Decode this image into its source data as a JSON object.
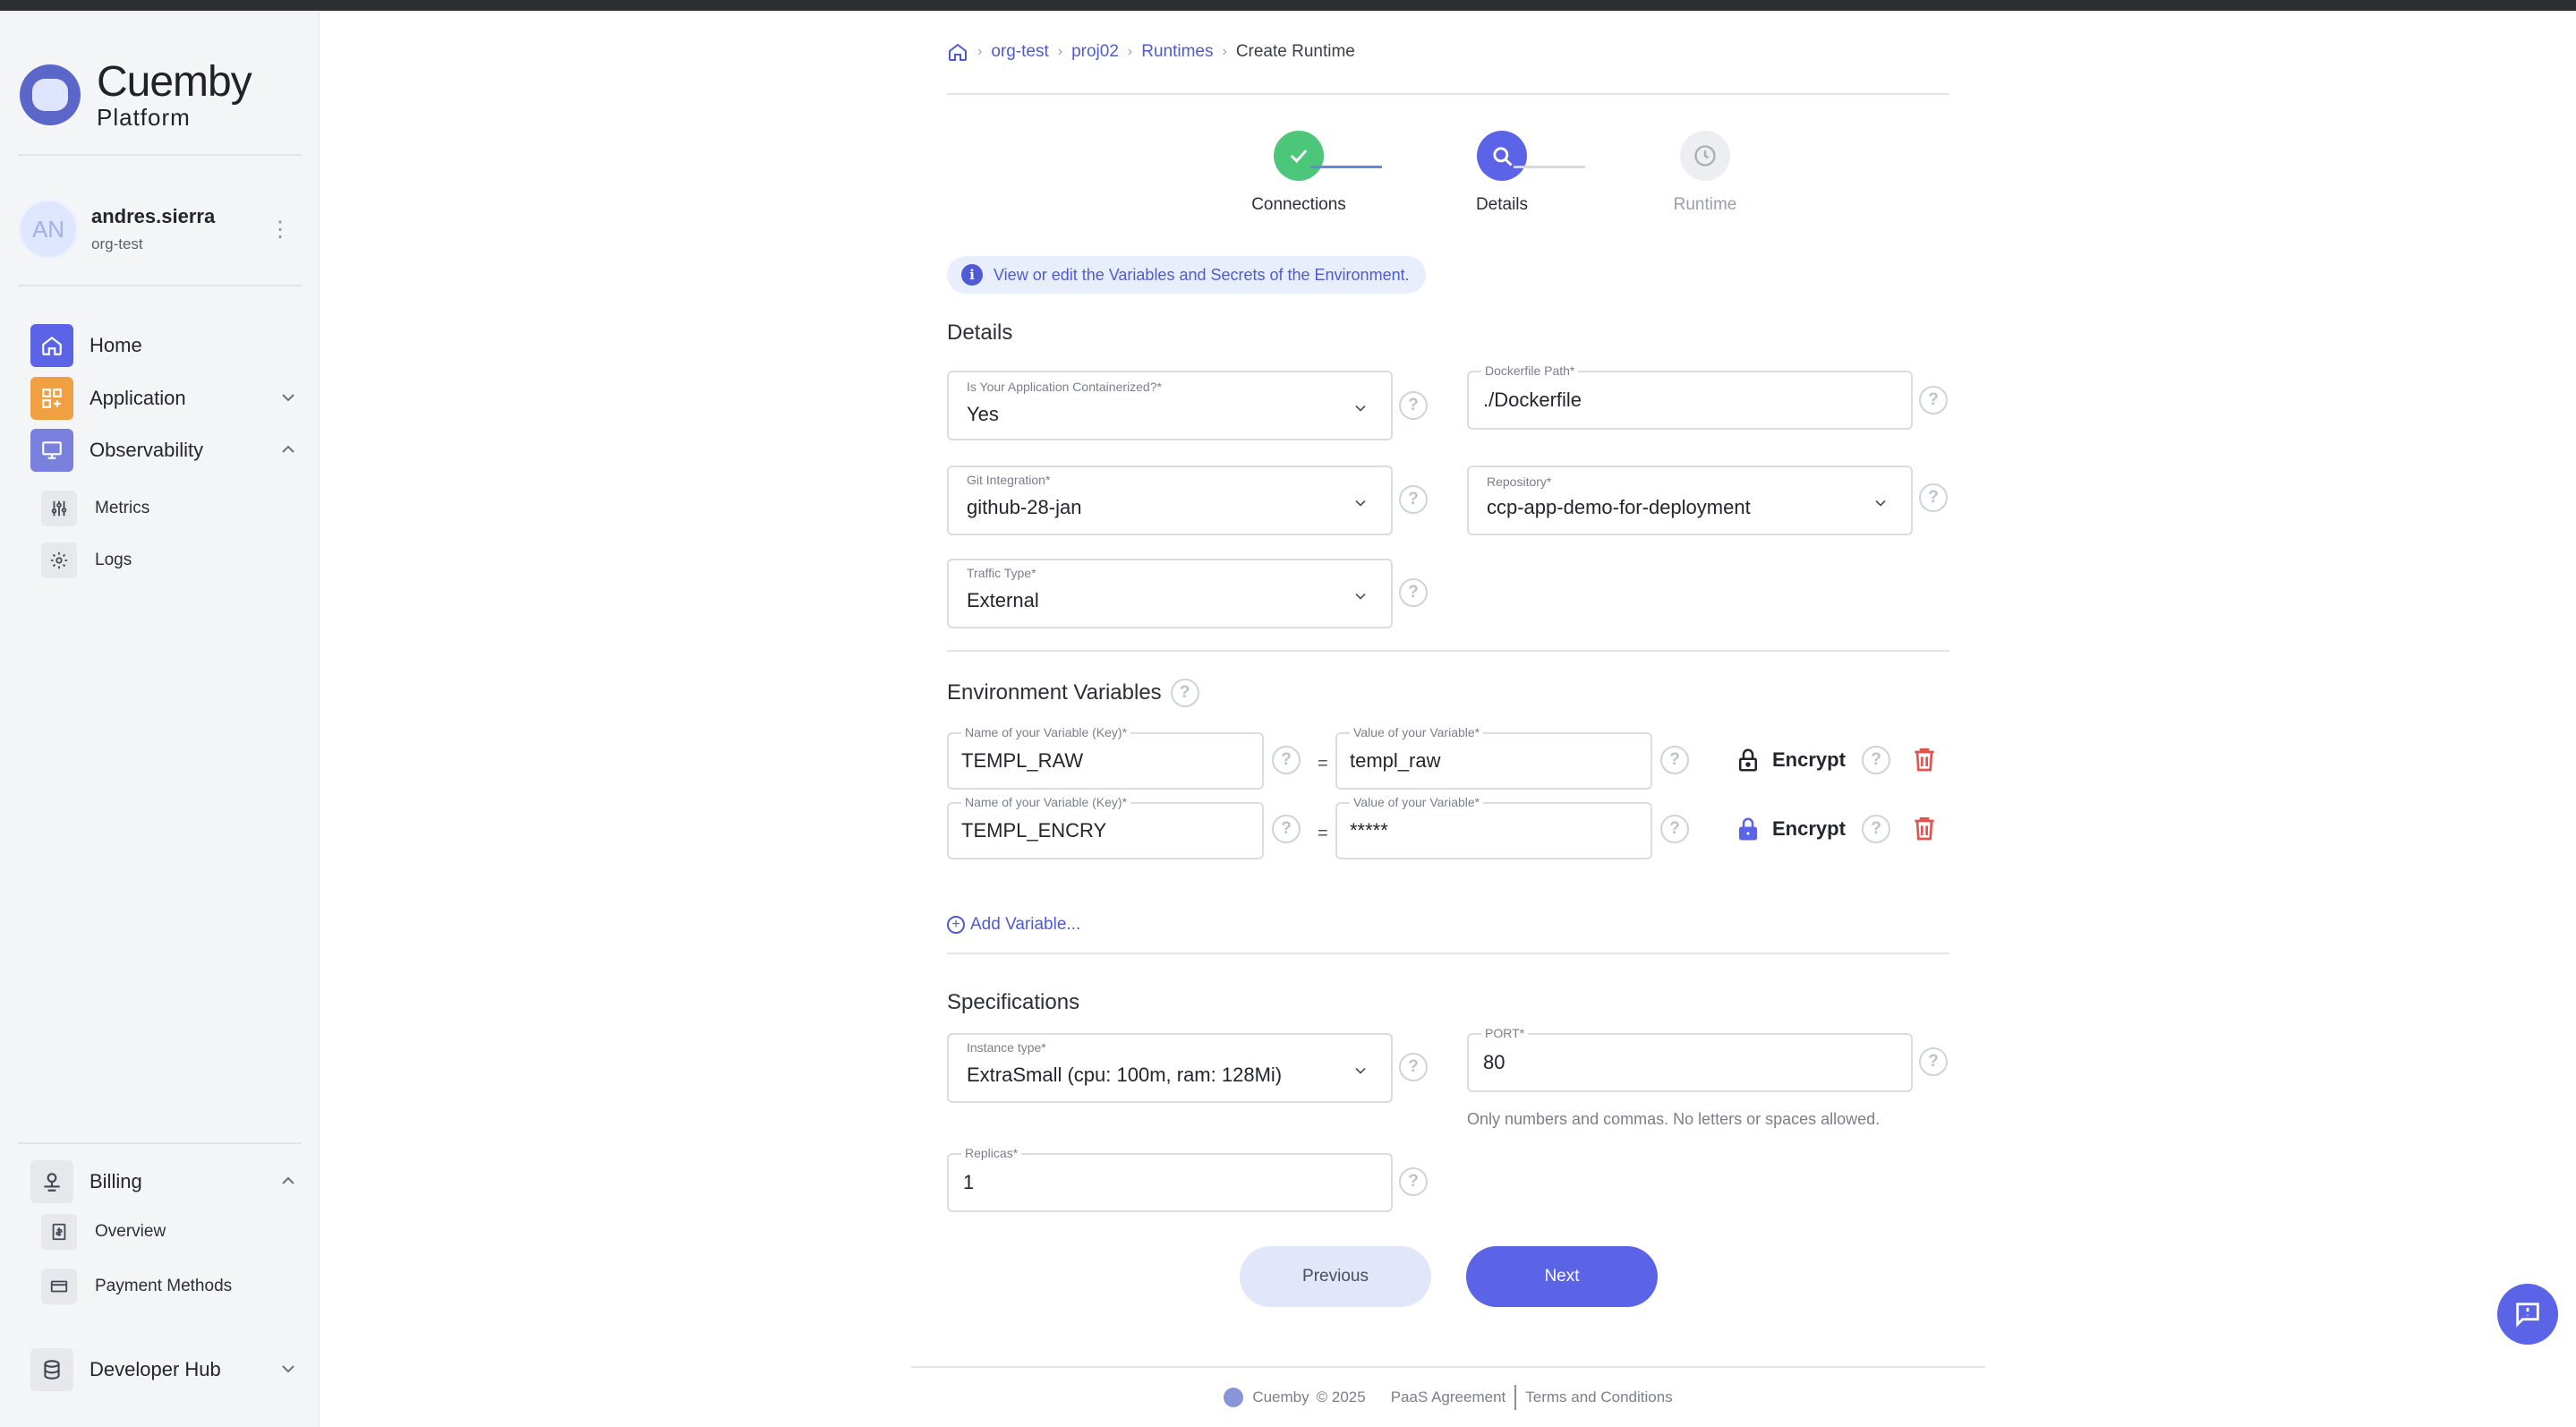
{
  "app": {
    "logo_title": "Cuemby",
    "logo_subtitle": "Platform"
  },
  "user": {
    "initials": "AN",
    "name": "andres.sierra",
    "org": "org-test"
  },
  "sidebar": {
    "home": "Home",
    "application": "Application",
    "observability": "Observability",
    "metrics": "Metrics",
    "logs": "Logs",
    "billing": "Billing",
    "overview": "Overview",
    "payment_methods": "Payment Methods",
    "developer_hub": "Developer Hub",
    "colors": {
      "home": "#5b63e6",
      "application": "#f0a040",
      "observability": "#7a80de"
    }
  },
  "breadcrumb": {
    "items": [
      "org-test",
      "proj02",
      "Runtimes"
    ],
    "current": "Create Runtime"
  },
  "stepper": {
    "steps": [
      {
        "label": "Connections",
        "state": "completed"
      },
      {
        "label": "Details",
        "state": "active"
      },
      {
        "label": "Runtime",
        "state": "pending"
      }
    ]
  },
  "info_banner": "View or edit the Variables and Secrets of the Environment.",
  "details": {
    "title": "Details",
    "containerized": {
      "label": "Is Your Application Containerized?*",
      "value": "Yes"
    },
    "dockerfile_path": {
      "label": "Dockerfile Path*",
      "value": "./Dockerfile"
    },
    "git_integration": {
      "label": "Git Integration*",
      "value": "github-28-jan"
    },
    "repository": {
      "label": "Repository*",
      "value": "ccp-app-demo-for-deployment"
    },
    "traffic_type": {
      "label": "Traffic Type*",
      "value": "External"
    }
  },
  "env_vars": {
    "title": "Environment Variables",
    "key_label": "Name of your Variable (Key)*",
    "value_label": "Value of your Variable*",
    "equals": "=",
    "encrypt_label": "Encrypt",
    "rows": [
      {
        "key": "TEMPL_RAW",
        "value": "templ_raw",
        "encrypted": false
      },
      {
        "key": "TEMPL_ENCRY",
        "value": "*****",
        "encrypted": true
      }
    ],
    "add_label": "Add Variable..."
  },
  "specs": {
    "title": "Specifications",
    "instance_type": {
      "label": "Instance type*",
      "value": "ExtraSmall (cpu: 100m, ram: 128Mi)"
    },
    "port": {
      "label": "PORT*",
      "value": "80",
      "hint": "Only numbers and commas. No letters or spaces allowed."
    },
    "replicas": {
      "label": "Replicas*",
      "value": "1"
    }
  },
  "actions": {
    "previous": "Previous",
    "next": "Next"
  },
  "footer": {
    "brand": "Cuemby",
    "copyright": "© 2025",
    "paas": "PaaS Agreement",
    "terms": "Terms and Conditions"
  }
}
